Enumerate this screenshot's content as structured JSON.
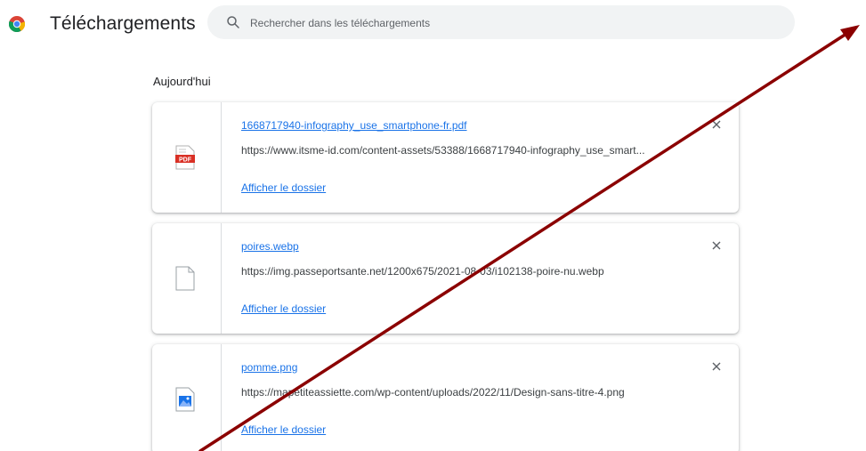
{
  "header": {
    "title": "Téléchargements",
    "search_placeholder": "Rechercher dans les téléchargements"
  },
  "section": {
    "label": "Aujourd'hui"
  },
  "downloads": [
    {
      "file_name": "1668717940-infography_use_smartphone-fr.pdf",
      "url": "https://www.itsme-id.com/content-assets/53388/1668717940-infography_use_smart...",
      "action_label": "Afficher le dossier",
      "icon": "pdf-file-icon",
      "icon_text": "PDF"
    },
    {
      "file_name": "poires.webp",
      "url": "https://img.passeportsante.net/1200x675/2021-08-03/i102138-poire-nu.webp",
      "action_label": "Afficher le dossier",
      "icon": "generic-file-icon"
    },
    {
      "file_name": "pomme.png",
      "url": "https://mapetiteassiette.com/wp-content/uploads/2022/11/Design-sans-titre-4.png",
      "action_label": "Afficher le dossier",
      "icon": "image-file-icon"
    }
  ],
  "colors": {
    "link": "#1a73e8",
    "pdf_red": "#d93025",
    "arrow": "#8b0000",
    "search_bg": "#f1f3f4"
  }
}
